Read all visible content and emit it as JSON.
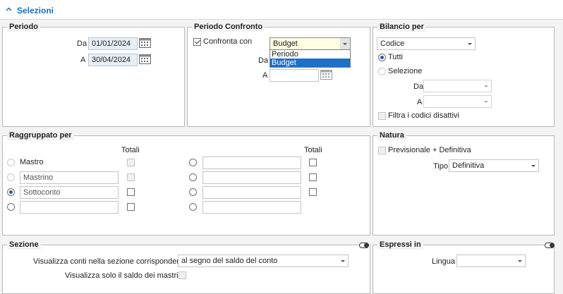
{
  "header": {
    "title": "Selezioni"
  },
  "periodo": {
    "legend": "Periodo",
    "da_label": "Da",
    "da_value": "01/01/2024",
    "a_label": "A",
    "a_value": "30/04/2024"
  },
  "periodo_confronto": {
    "legend": "Periodo Confronto",
    "confronta_label": "Confronta con",
    "confronta_checked": true,
    "selected": "Budget",
    "options": [
      "Periodo",
      "Budget"
    ],
    "da_label": "Da",
    "a_label": "A",
    "a_value": ""
  },
  "bilancio": {
    "legend": "Bilancio per",
    "selected": "Codice",
    "tutti_label": "Tutti",
    "selezione_label": "Selezione",
    "da_label": "Da",
    "a_label": "A",
    "filtra_label": "Filtra i codici disattivi"
  },
  "raggruppato": {
    "legend": "Raggruppato per",
    "totali_left": "Totali",
    "totali_right": "Totali",
    "mastro_label": "Mastro",
    "rows_left": [
      "Mastrino",
      "Sottoconto",
      ""
    ]
  },
  "natura": {
    "legend": "Natura",
    "prev_label": "Previsionale + Definitiva",
    "tipo_label": "Tipo",
    "tipo_value": "Definitiva"
  },
  "sezione": {
    "legend": "Sezione",
    "visualizza_label": "Visualizza conti nella sezione corrispondente",
    "visualizza_value": "al segno del saldo del conto",
    "saldo_label": "Visualizza solo il saldo dei mastrini"
  },
  "espressi": {
    "legend": "Espressi in",
    "lingua_label": "Lingua",
    "lingua_value": ""
  },
  "colors": {
    "accent": "#1a6fb5",
    "selection": "#1f6fc7",
    "date_field": "#e8eef5",
    "highlight_select": "#fffce0"
  },
  "icons": [
    "chevron-up-icon",
    "calendar-icon",
    "toggle-icon",
    "dropdown-arrow-icon"
  ]
}
